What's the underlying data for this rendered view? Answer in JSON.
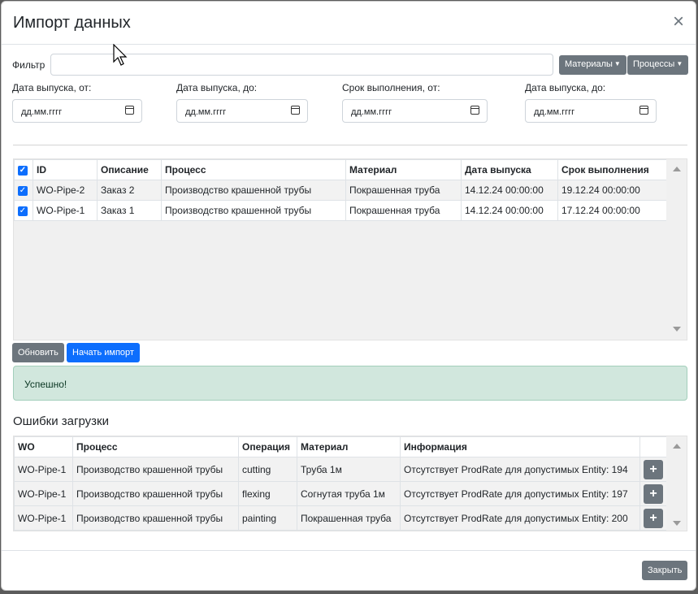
{
  "modal": {
    "title": "Импорт данных",
    "close_label": "×"
  },
  "filter": {
    "label": "Фильтр",
    "value": "",
    "materials_button": "Материалы",
    "processes_button": "Процессы"
  },
  "dates": [
    {
      "label": "Дата выпуска, от:",
      "value": "дд.мм.гггг"
    },
    {
      "label": "Дата выпуска, до:",
      "value": "дд.мм.гггг"
    },
    {
      "label": "Срок выполнения, от:",
      "value": "дд.мм.гггг"
    },
    {
      "label": "Дата выпуска, до:",
      "value": "дд.мм.гггг"
    }
  ],
  "orders_table": {
    "columns": [
      "ID",
      "Описание",
      "Процесс",
      "Материал",
      "Дата выпуска",
      "Срок выполнения"
    ],
    "rows": [
      {
        "checked": true,
        "id": "WO-Pipe-2",
        "description": "Заказ 2",
        "process": "Производство крашенной трубы",
        "material": "Покрашенная труба",
        "release_date": "14.12.24 00:00:00",
        "due_date": "19.12.24 00:00:00"
      },
      {
        "checked": true,
        "id": "WO-Pipe-1",
        "description": "Заказ 1",
        "process": "Производство крашенной трубы",
        "material": "Покрашенная труба",
        "release_date": "14.12.24 00:00:00",
        "due_date": "17.12.24 00:00:00"
      }
    ]
  },
  "actions": {
    "refresh": "Обновить",
    "start_import": "Начать импорт"
  },
  "alert": {
    "text": "Успешно!",
    "color": "#d1e7dd"
  },
  "errors": {
    "title": "Ошибки загрузки",
    "columns": [
      "WO",
      "Процесс",
      "Операция",
      "Материал",
      "Информация",
      ""
    ],
    "rows": [
      {
        "wo": "WO-Pipe-1",
        "process": "Производство крашенной трубы",
        "operation": "cutting",
        "material": "Труба 1м",
        "info": "Отсутствует ProdRate для допустимых Entity: 194"
      },
      {
        "wo": "WO-Pipe-1",
        "process": "Производство крашенной трубы",
        "operation": "flexing",
        "material": "Согнутая труба 1м",
        "info": "Отсутствует ProdRate для допустимых Entity: 197"
      },
      {
        "wo": "WO-Pipe-1",
        "process": "Производство крашенной трубы",
        "operation": "painting",
        "material": "Покрашенная труба",
        "info": "Отсутствует ProdRate для допустимых Entity: 200"
      }
    ],
    "add_label": "+"
  },
  "footer": {
    "close_button": "Закрыть"
  },
  "colors": {
    "primary": "#0d6efd",
    "secondary": "#6c757d",
    "success_bg": "#d1e7dd"
  }
}
